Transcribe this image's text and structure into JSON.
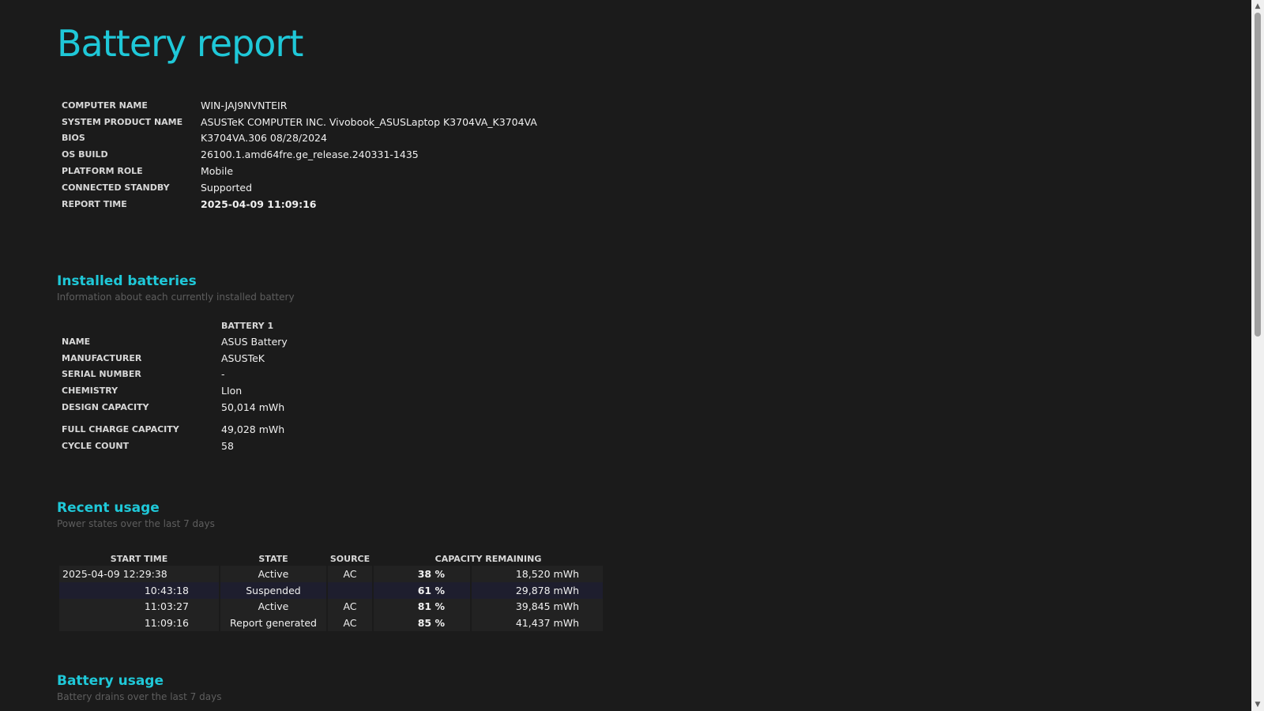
{
  "title": "Battery report",
  "system": [
    {
      "key": "COMPUTER NAME",
      "value": "WIN-JAJ9NVNTEIR"
    },
    {
      "key": "SYSTEM PRODUCT NAME",
      "value": "ASUSTeK COMPUTER INC. Vivobook_ASUSLaptop K3704VA_K3704VA"
    },
    {
      "key": "BIOS",
      "value": "K3704VA.306 08/28/2024"
    },
    {
      "key": "OS BUILD",
      "value": "26100.1.amd64fre.ge_release.240331-1435"
    },
    {
      "key": "PLATFORM ROLE",
      "value": "Mobile"
    },
    {
      "key": "CONNECTED STANDBY",
      "value": "Supported"
    },
    {
      "key": "REPORT TIME",
      "value": "2025-04-09  11:09:16"
    }
  ],
  "installed": {
    "title": "Installed batteries",
    "subtitle": "Information about each currently installed battery",
    "column": "BATTERY 1",
    "rows": [
      {
        "key": "NAME",
        "value": "ASUS Battery"
      },
      {
        "key": "MANUFACTURER",
        "value": "ASUSTeK"
      },
      {
        "key": "SERIAL NUMBER",
        "value": "-"
      },
      {
        "key": "CHEMISTRY",
        "value": "LIon"
      },
      {
        "key": "DESIGN CAPACITY",
        "value": "50,014 mWh"
      },
      {
        "key": "FULL CHARGE CAPACITY",
        "value": "49,028 mWh"
      },
      {
        "key": "CYCLE COUNT",
        "value": "58"
      }
    ]
  },
  "recent": {
    "title": "Recent usage",
    "subtitle": "Power states over the last 7 days",
    "headers": {
      "start": "START TIME",
      "state": "STATE",
      "source": "SOURCE",
      "capacity": "CAPACITY REMAINING"
    },
    "rows": [
      {
        "start": "2025-04-09  12:29:38",
        "state": "Active",
        "source": "AC",
        "pct": "38 %",
        "mwh": "18,520 mWh"
      },
      {
        "start": "10:43:18",
        "state": "Suspended",
        "source": "",
        "pct": "61 %",
        "mwh": "29,878 mWh"
      },
      {
        "start": "11:03:27",
        "state": "Active",
        "source": "AC",
        "pct": "81 %",
        "mwh": "39,845 mWh"
      },
      {
        "start": "11:09:16",
        "state": "Report generated",
        "source": "AC",
        "pct": "85 %",
        "mwh": "41,437 mWh"
      }
    ]
  },
  "battery_usage": {
    "title": "Battery usage",
    "subtitle": "Battery drains over the last 7 days"
  },
  "colors": {
    "background": "#1b1b1b",
    "accent": "#1fc8d8"
  }
}
